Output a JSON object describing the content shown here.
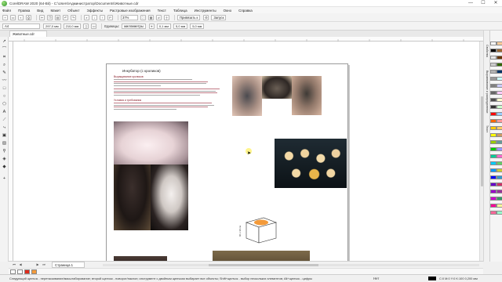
{
  "window": {
    "title": "CorelDRAW 2020 (64-Bit) - C:\\Users\\Администратор\\Documents\\Животные.cdr",
    "minimize": "—",
    "maximize": "☐",
    "close": "✕"
  },
  "menu": [
    "Файл",
    "Правка",
    "Вид",
    "Макет",
    "Объект",
    "Эффекты",
    "Растровые изображения",
    "Текст",
    "Таблица",
    "Инструменты",
    "Окно",
    "Справка"
  ],
  "toolbar": {
    "zoom": "37%",
    "snap_label": "Привязать к",
    "launch_label": "Запуск"
  },
  "property_bar": {
    "page_size": "A4",
    "width": "297,0 мм",
    "height": "210,0 мм",
    "units_label": "Единицы:",
    "units_value": "миллиметры",
    "nudge": "0,1 мм",
    "dup_x": "5,0 мм",
    "dup_y": "5,0 мм"
  },
  "document": {
    "tab_name": "Животные.cdr",
    "heading": "Инкубатор (с кроликов)",
    "subheading_1": "Выращивание кроликов",
    "subheading_2": "Условия и требования",
    "box_label": "40 х 30 см"
  },
  "page_bar": {
    "first": "⏮",
    "prev": "◀",
    "next": "▶",
    "last": "⏭",
    "page_tab": "Страница 1"
  },
  "status": {
    "hint": "Следующий щелчок - перетаскивание/масштабирование; второй щелчок - поворот/наклон; инструмент с двойным щелчком выбирает все объекты; Shift+щелчок - выбор нескольких элементов; Alt+щелчок - цифры",
    "fill": "Нет",
    "outline": "C:0 M:0 Y:0 K:100  0,200 мм"
  },
  "dockers": [
    "Свойства",
    "Выравнивание и распределение",
    "Текст"
  ],
  "colors": {
    "accent": "#2a7fd4",
    "document_red": "#e02a1b",
    "document_orange": "#f39a3a"
  }
}
